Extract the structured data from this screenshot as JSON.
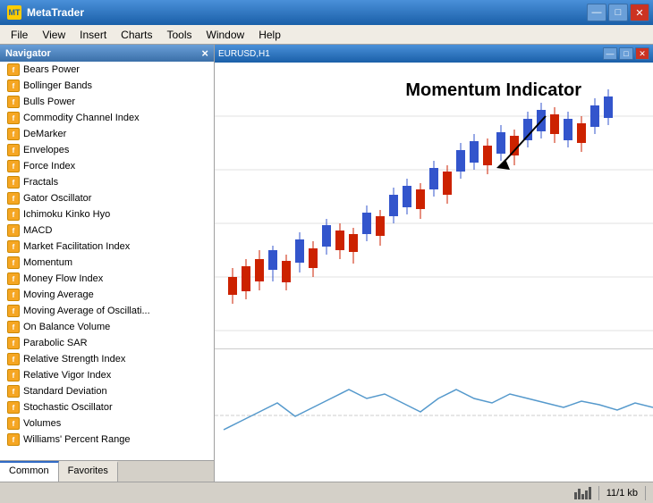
{
  "window": {
    "title": "MetaTrader",
    "controls": {
      "minimize": "—",
      "maximize": "□",
      "close": "✕"
    }
  },
  "menu": {
    "items": [
      "File",
      "View",
      "Insert",
      "Charts",
      "Tools",
      "Window",
      "Help"
    ]
  },
  "navigator": {
    "title": "Navigator",
    "close": "×",
    "indicators": [
      "Bears Power",
      "Bollinger Bands",
      "Bulls Power",
      "Commodity Channel Index",
      "DeMarker",
      "Envelopes",
      "Force Index",
      "Fractals",
      "Gator Oscillator",
      "Ichimoku Kinko Hyo",
      "MACD",
      "Market Facilitation Index",
      "Momentum",
      "Money Flow Index",
      "Moving Average",
      "Moving Average of Oscillati...",
      "On Balance Volume",
      "Parabolic SAR",
      "Relative Strength Index",
      "Relative Vigor Index",
      "Standard Deviation",
      "Stochastic Oscillator",
      "Volumes",
      "Williams' Percent Range"
    ],
    "tabs": [
      "Common",
      "Favorites"
    ]
  },
  "chart": {
    "inner_controls": {
      "minimize": "—",
      "maximize": "□",
      "close": "✕"
    },
    "annotation": "Momentum Indicator"
  },
  "status_bar": {
    "chart_info": "11/1 kb"
  }
}
